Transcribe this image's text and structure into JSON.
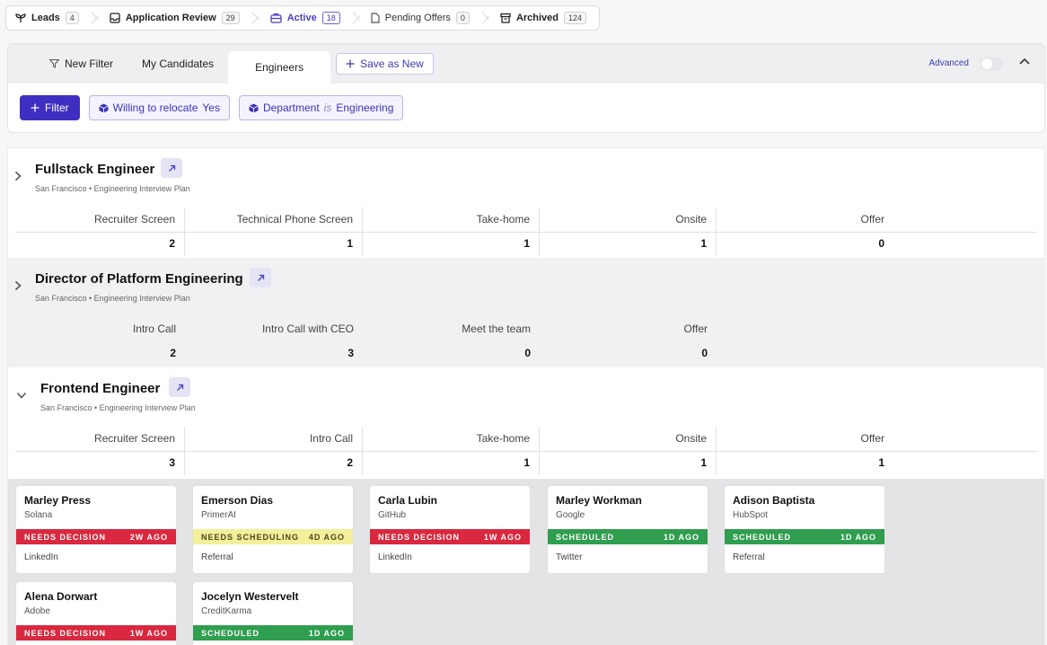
{
  "stage_bar": [
    {
      "label": "Leads",
      "count": "4",
      "icon": "sprout-icon"
    },
    {
      "label": "Application Review",
      "count": "29",
      "icon": "inbox-icon"
    },
    {
      "label": "Active",
      "count": "18",
      "icon": "briefcase-icon"
    },
    {
      "label": "Pending Offers",
      "count": "0",
      "icon": "document-icon"
    },
    {
      "label": "Archived",
      "count": "124",
      "icon": "archive-icon"
    }
  ],
  "filter_tabs": {
    "new_filter": "New Filter",
    "my_candidates": "My Candidates",
    "engineers": "Engineers",
    "save_as_new": "Save as New",
    "advanced": "Advanced"
  },
  "filters": {
    "filter_button": "Filter",
    "chip1": {
      "label": "Willing to relocate",
      "value": "Yes"
    },
    "chip2": {
      "label": "Department",
      "op": "is",
      "value": "Engineering"
    }
  },
  "jobs": [
    {
      "title": "Fullstack Engineer",
      "subtitle": "San Francisco • Engineering Interview Plan",
      "stages": [
        {
          "name": "Recruiter Screen",
          "count": "2"
        },
        {
          "name": "Technical Phone Screen",
          "count": "1"
        },
        {
          "name": "Take-home",
          "count": "1"
        },
        {
          "name": "Onsite",
          "count": "1"
        },
        {
          "name": "Offer",
          "count": "0"
        }
      ]
    },
    {
      "title": "Director of Platform Engineering",
      "subtitle": "San Francisco • Engineering Interview Plan",
      "stages": [
        {
          "name": "Intro Call",
          "count": "2"
        },
        {
          "name": "Intro Call with CEO",
          "count": "3"
        },
        {
          "name": "Meet the team",
          "count": "0"
        },
        {
          "name": "Offer",
          "count": "0"
        }
      ]
    },
    {
      "title": "Frontend Engineer",
      "subtitle": "San Francisco • Engineering Interview Plan",
      "stages": [
        {
          "name": "Recruiter Screen",
          "count": "3"
        },
        {
          "name": "Intro Call",
          "count": "2"
        },
        {
          "name": "Take-home",
          "count": "1"
        },
        {
          "name": "Onsite",
          "count": "1"
        },
        {
          "name": "Offer",
          "count": "1"
        }
      ]
    }
  ],
  "candidates": [
    {
      "name": "Marley Press",
      "company": "Solana",
      "status": "NEEDS DECISION",
      "age": "2W AGO",
      "source": "LinkedIn",
      "color": "red"
    },
    {
      "name": "Emerson Dias",
      "company": "PrimerAI",
      "status": "NEEDS SCHEDULING",
      "age": "4D AGO",
      "source": "Referral",
      "color": "yellow"
    },
    {
      "name": "Carla Lubin",
      "company": "GitHub",
      "status": "NEEDS DECISION",
      "age": "1W AGO",
      "source": "LinkedIn",
      "color": "red"
    },
    {
      "name": "Marley Workman",
      "company": "Google",
      "status": "SCHEDULED",
      "age": "1D AGO",
      "source": "Twitter",
      "color": "green"
    },
    {
      "name": "Adison Baptista",
      "company": "HubSpot",
      "status": "SCHEDULED",
      "age": "1D AGO",
      "source": "Referral",
      "color": "green"
    },
    {
      "name": "Alena Dorwart",
      "company": "Adobe",
      "status": "NEEDS DECISION",
      "age": "1W AGO",
      "source": "",
      "color": "red"
    },
    {
      "name": "Jocelyn Westervelt",
      "company": "CreditKarma",
      "status": "SCHEDULED",
      "age": "1D AGO",
      "source": "",
      "color": "green"
    }
  ],
  "colors": {
    "accent": "#3f2fc0",
    "red": "#d9283f",
    "yellow": "#f3ef9a",
    "green": "#2f9e4f"
  }
}
